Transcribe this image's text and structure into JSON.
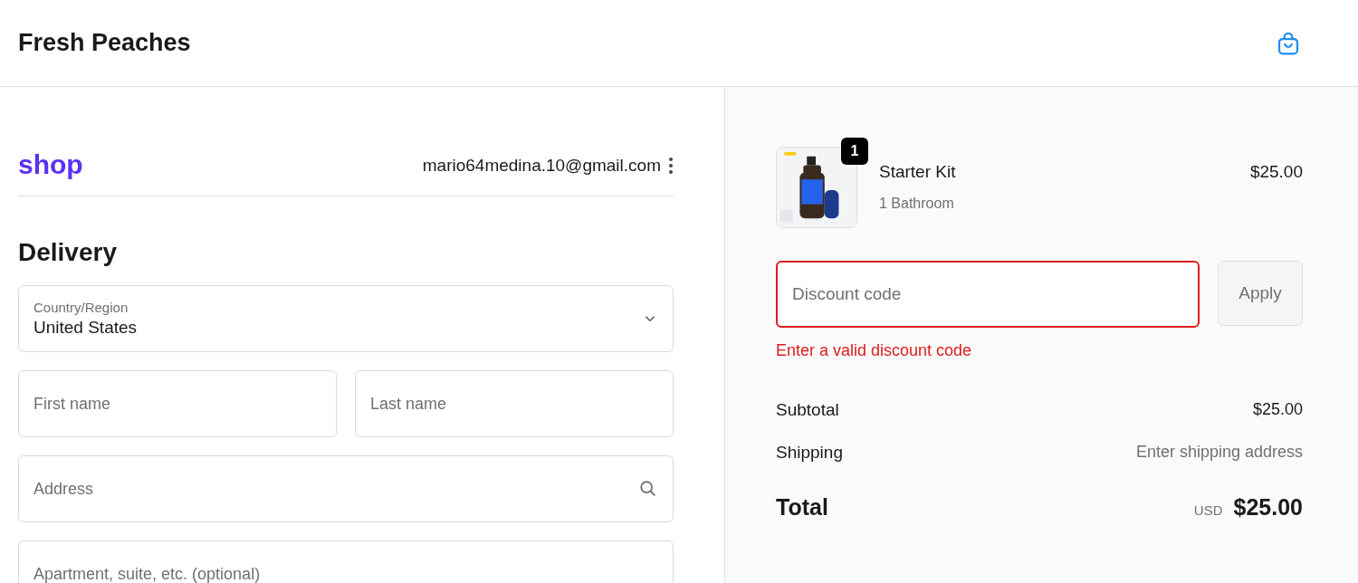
{
  "header": {
    "store_name": "Fresh Peaches"
  },
  "account": {
    "logo": "shop",
    "email": "mario64medina.10@gmail.com"
  },
  "delivery": {
    "heading": "Delivery",
    "country": {
      "label": "Country/Region",
      "value": "United States"
    },
    "fields": [
      {
        "kind": "half",
        "placeholder": "First name"
      },
      {
        "kind": "half",
        "placeholder": "Last name"
      },
      {
        "kind": "search",
        "placeholder": "Address"
      },
      {
        "kind": "full",
        "placeholder": "Apartment, suite, etc. (optional)"
      }
    ]
  },
  "order": {
    "items": [
      {
        "name": "Starter Kit",
        "variant": "1 Bathroom",
        "quantity": "1",
        "price": "$25.00"
      }
    ],
    "discount": {
      "placeholder": "Discount code",
      "invalid": true,
      "error": "Enter a valid discount code",
      "button": "Apply",
      "disabled": true
    },
    "lines": [
      {
        "label": "Subtotal",
        "value": "$25.00",
        "muted": false
      },
      {
        "label": "Shipping",
        "value": "Enter shipping address",
        "muted": true
      }
    ],
    "total": {
      "label": "Total",
      "currency": "USD",
      "value": "$25.00"
    }
  }
}
